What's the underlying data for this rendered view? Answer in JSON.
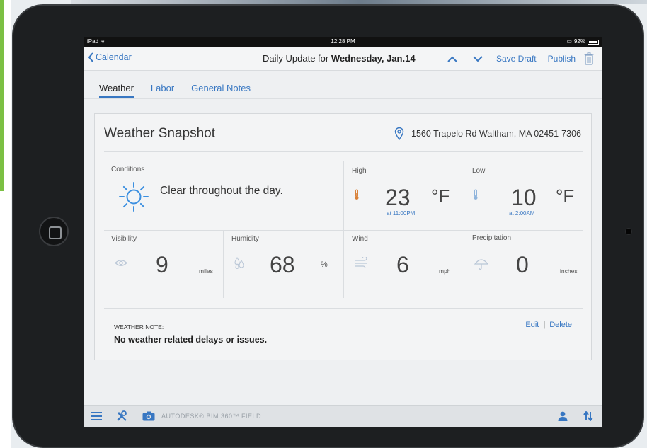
{
  "status_bar": {
    "device": "iPad",
    "time": "12:28 PM",
    "battery": "92%"
  },
  "nav": {
    "back_label": "Calendar",
    "title_prefix": "Daily Update for ",
    "title_date": "Wednesday, Jan.14",
    "save_draft": "Save Draft",
    "publish": "Publish"
  },
  "tabs": [
    {
      "label": "Weather",
      "active": true
    },
    {
      "label": "Labor",
      "active": false
    },
    {
      "label": "General Notes",
      "active": false
    }
  ],
  "weather": {
    "title": "Weather Snapshot",
    "address": "1560 Trapelo Rd Waltham, MA 02451-7306",
    "conditions": {
      "label": "Conditions",
      "text": "Clear throughout the day."
    },
    "high": {
      "label": "High",
      "value": "23",
      "unit": "°F",
      "time": "at 11:00PM"
    },
    "low": {
      "label": "Low",
      "value": "10",
      "unit": "°F",
      "time": "at 2:00AM"
    },
    "visibility": {
      "label": "Visibility",
      "value": "9",
      "unit": "miles"
    },
    "humidity": {
      "label": "Humidity",
      "value": "68",
      "unit": "%"
    },
    "wind": {
      "label": "Wind",
      "value": "6",
      "unit": "mph"
    },
    "precipitation": {
      "label": "Precipitation",
      "value": "0",
      "unit": "inches"
    },
    "note": {
      "label": "WEATHER NOTE:",
      "text": "No weather related delays or issues.",
      "edit": "Edit",
      "separator": "|",
      "delete": "Delete"
    }
  },
  "bottom_bar": {
    "brand": "AUTODESK® BIM 360™ FIELD"
  },
  "colors": {
    "accent": "#3877c2",
    "sun": "#3b8fe0",
    "thermo_high": "#d9823a",
    "thermo_low": "#8fb4dc"
  }
}
